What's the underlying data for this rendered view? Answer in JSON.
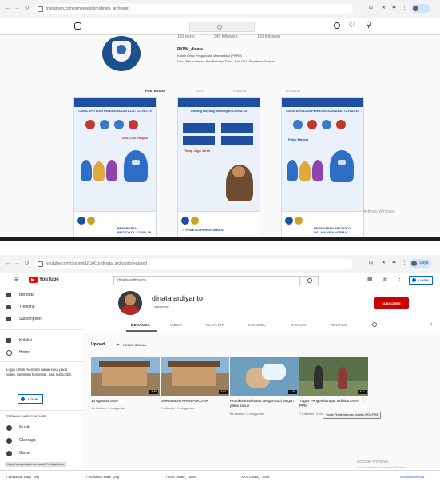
{
  "top": {
    "browser": {
      "url": "instagram.com/ormawa/ppkm/dinata_ardiyanto"
    },
    "instagram": {
      "stats": [
        "180 posts",
        "345 followers",
        "180 following"
      ],
      "profile_name": "PKPM_dinata",
      "bio_line1": "Kuliah Kerja Pengabdian Masyarakat (PKPM)",
      "bio_line2": "Desa Batun Wetan, Kec.Baturaja Timur, Kab.OKU Sumatera Selatan",
      "tabs": [
        "POSTINGAN",
        "IGTV",
        "DITANDAI",
        "DITANDAI"
      ],
      "posts": [
        {
          "title": "CARA APD DAN PENGGUNAAN ALAT COVID-19",
          "subtitle": "Ayo Cuci Tangan",
          "footer": "PENERAPAN PROTOKOL COVID-19"
        },
        {
          "title": "Gotong Royong Mencegah COVID-19",
          "subtitle": "Tetap Jaga Jarak",
          "footer": "3 PRAKTIS PENCEGAHAN"
        },
        {
          "title": "CARA APD DAN PENGGUNAAN ALAT COVID-19",
          "subtitle": "Pakai Masker",
          "footer": "PENERAPAN PROTOKOL DALAM NEW NORMAL"
        }
      ],
      "watermark": "Activate Windows"
    }
  },
  "bottom": {
    "browser": {
      "url": "youtube.com/channel/UCeKzo-dinata_ardiyanto/featured",
      "profile_label": "Saya"
    },
    "youtube": {
      "logo_text": "YouTube",
      "search_value": "dinata ardiyanto",
      "signin_label": "LOGIN",
      "sidebar": {
        "main": [
          "Beranda",
          "Trending",
          "Subscription"
        ],
        "library": [
          "Koleksi",
          "Histori"
        ],
        "login_prompt": "Login untuk memberi hariai suka pada video, memberi komentar, dan subscribe.",
        "login_button": "LOGIN",
        "section_title": "TERBAIK DARI YOUTUBE",
        "best": [
          "Musik",
          "Olahraga",
          "Game"
        ]
      },
      "channel": {
        "name": "dinata ardiyanto",
        "subscribers": "1 subscriber",
        "subscribe_label": "SUBSCRIBE",
        "tabs": [
          "BERANDA",
          "VIDEO",
          "PLAYLIST",
          "CHANNEL",
          "DISKUSI",
          "TENTANG"
        ]
      },
      "section": {
        "title": "Upload",
        "play_all": "PUTAR SEMUA"
      },
      "videos": [
        {
          "title": "14 Agustus 2020",
          "meta": "4 x ditonton • 1 minggu lalu",
          "duration": "3:49"
        },
        {
          "title": "UMKM BERTAHAN PAK JAIR",
          "meta": "8 x ditonton • 1 minggu lalu",
          "duration": "4:03"
        },
        {
          "title": "Protokol Kesehatan dengan cuci tangan pakai sabun",
          "meta": "6 x ditonton • 2 minggu lalu",
          "duration": "1:26"
        },
        {
          "title": "Tugas Pengembangan Individu KKN-PPM",
          "meta": "7 x ditonton • 2 minggu lalu",
          "duration": "4:11"
        }
      ],
      "tooltip": "Tugas Pengembangan Individu KKN-PPM",
      "status_url": "https://www.youtube.com/watch?v=dinata-kkn",
      "watermark_line1": "Activate Windows",
      "watermark_line2": "Go to Settings to activate Windows."
    },
    "taskbar": {
      "items": [
        "Workshop imaje ..png",
        "Workshop imaje ..png",
        "KKN Dinata_ ..docx",
        "KKN Dinata_ ..docx"
      ],
      "right": "Tampilkan semua"
    }
  }
}
